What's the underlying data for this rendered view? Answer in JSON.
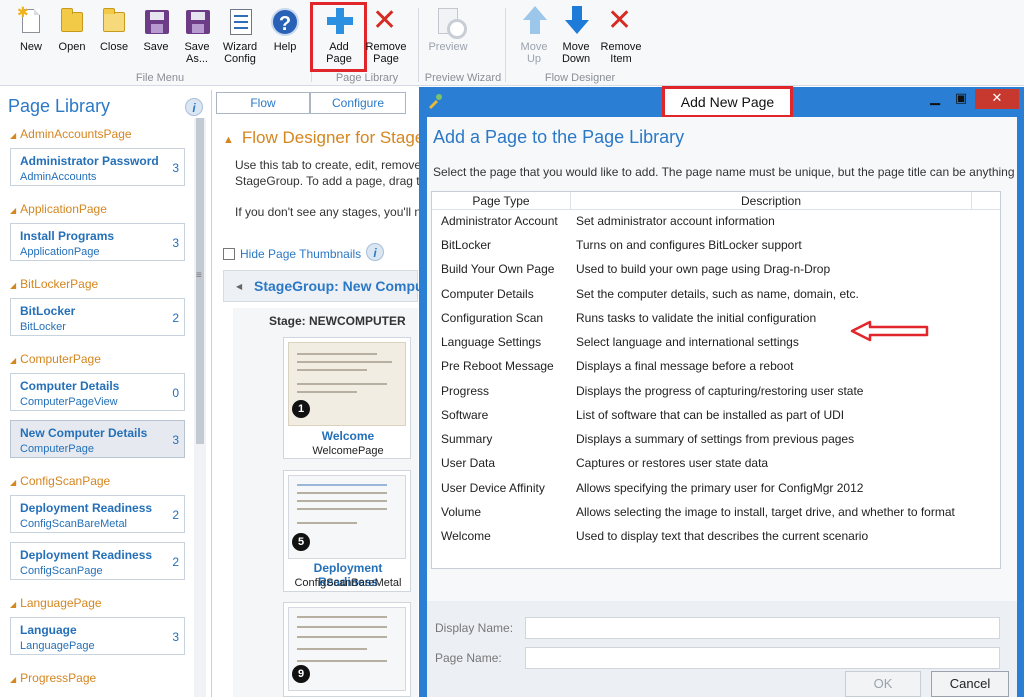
{
  "ribbon": {
    "buttons": [
      {
        "label": "New"
      },
      {
        "label": "Open"
      },
      {
        "label": "Close"
      },
      {
        "label": "Save"
      },
      {
        "label": "Save\nAs..."
      },
      {
        "label": "Wizard\nConfig"
      },
      {
        "label": "Help"
      },
      {
        "label": "Add\nPage"
      },
      {
        "label": "Remove\nPage"
      },
      {
        "label": "Preview"
      },
      {
        "label": "Move\nUp"
      },
      {
        "label": "Move\nDown"
      },
      {
        "label": "Remove\nItem"
      }
    ],
    "groups": {
      "file_menu": "File Menu",
      "page_library": "Page Library",
      "preview_wizard": "Preview Wizard",
      "flow_designer": "Flow Designer"
    }
  },
  "library": {
    "title": "Page Library",
    "categories": [
      {
        "name": "AdminAccountsPage",
        "items": [
          {
            "title": "Administrator Password",
            "sub": "AdminAccounts",
            "count": "3"
          }
        ]
      },
      {
        "name": "ApplicationPage",
        "items": [
          {
            "title": "Install Programs",
            "sub": "ApplicationPage",
            "count": "3"
          }
        ]
      },
      {
        "name": "BitLockerPage",
        "items": [
          {
            "title": "BitLocker",
            "sub": "BitLocker",
            "count": "2"
          }
        ]
      },
      {
        "name": "ComputerPage",
        "items": [
          {
            "title": "Computer Details",
            "sub": "ComputerPageView",
            "count": "0"
          },
          {
            "title": "New Computer Details",
            "sub": "ComputerPage",
            "count": "3"
          }
        ]
      },
      {
        "name": "ConfigScanPage",
        "items": [
          {
            "title": "Deployment Readiness",
            "sub": "ConfigScanBareMetal",
            "count": "2"
          },
          {
            "title": "Deployment Readiness",
            "sub": "ConfigScanPage",
            "count": "2"
          }
        ]
      },
      {
        "name": "LanguagePage",
        "items": [
          {
            "title": "Language",
            "sub": "LanguagePage",
            "count": "3"
          }
        ]
      },
      {
        "name": "ProgressPage",
        "items": []
      }
    ]
  },
  "flow": {
    "tabs": [
      "Flow",
      "Configure"
    ],
    "title": "Flow Designer for Stage",
    "text1": "Use this tab to create, edit, remove,",
    "text2": "StageGroup. To add a page, drag th",
    "text3": "If you don't see any stages, you'll ne",
    "hide_thumbnails": "Hide Page Thumbnails",
    "stage_group": "StageGroup: New Compu",
    "stage": "Stage: NEWCOMPUTER",
    "cards": [
      {
        "badge": "1",
        "title": "Welcome",
        "sub": "WelcomePage"
      },
      {
        "badge": "5",
        "title": "Deployment Readiness",
        "sub": "ConfigScanBareMetal"
      },
      {
        "badge": "9",
        "title": "",
        "sub": ""
      }
    ]
  },
  "dialog": {
    "title": "Add New Page",
    "heading": "Add a Page to the Page Library",
    "subtitle": "Select the page that you would like to add. The page name must be unique, but the page title can be anything",
    "col_type": "Page Type",
    "col_desc": "Description",
    "rows": [
      {
        "type": "Administrator Account",
        "desc": "Set administrator account information"
      },
      {
        "type": "BitLocker",
        "desc": "Turns on and configures BitLocker support"
      },
      {
        "type": "Build Your Own Page",
        "desc": "Used to build your own page using Drag-n-Drop"
      },
      {
        "type": "Computer Details",
        "desc": "Set the computer details, such as name, domain, etc."
      },
      {
        "type": "Configuration Scan",
        "desc": "Runs tasks to validate the initial configuration"
      },
      {
        "type": "Language Settings",
        "desc": "Select language and international settings"
      },
      {
        "type": "Pre Reboot Message",
        "desc": "Displays a final message before a reboot"
      },
      {
        "type": "Progress",
        "desc": "Displays the progress of capturing/restoring user state"
      },
      {
        "type": "Software",
        "desc": "List of software that can be installed as part of UDI"
      },
      {
        "type": "Summary",
        "desc": "Displays a summary of settings from previous pages"
      },
      {
        "type": "User Data",
        "desc": "Captures or restores user state data"
      },
      {
        "type": "User Device Affinity",
        "desc": "Allows specifying the primary user for ConfigMgr 2012"
      },
      {
        "type": "Volume",
        "desc": "Allows selecting the image to install, target drive, and whether to format"
      },
      {
        "type": "Welcome",
        "desc": "Used to display text that describes the current scenario"
      }
    ],
    "display_name_label": "Display Name:",
    "display_name_value": "",
    "page_name_label": "Page Name:",
    "page_name_value": "",
    "ok": "OK",
    "cancel": "Cancel"
  },
  "colors": {
    "accent_blue": "#2b79c6",
    "category_orange": "#d4861f",
    "highlight_red": "#e0262b",
    "dialog_frame": "#2a7fd4"
  }
}
